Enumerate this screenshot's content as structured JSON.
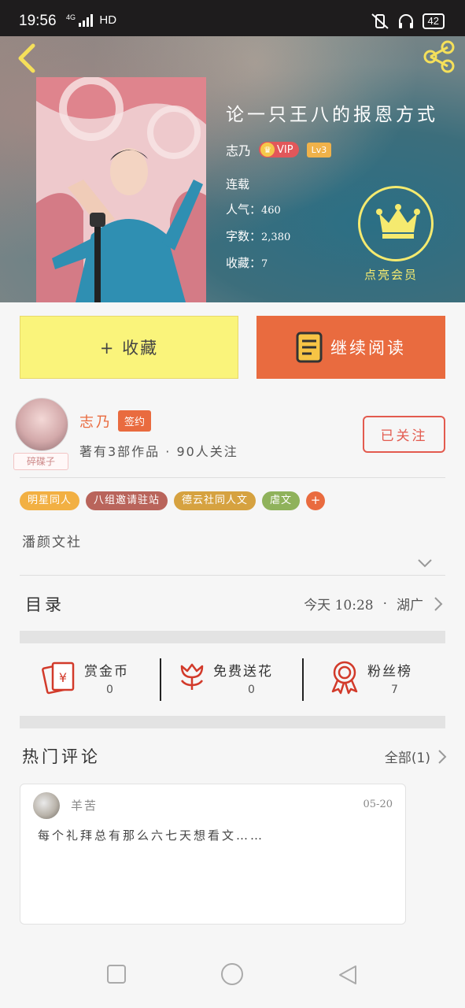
{
  "status_bar": {
    "time": "19:56",
    "network": "4G",
    "hd": "HD",
    "battery": "42"
  },
  "book": {
    "title": "论一只王八的报恩方式",
    "author": "志乃",
    "vip": "VIP",
    "level": "Lv3",
    "status": "连载",
    "popularity_label": "人气：",
    "popularity": "460",
    "words_label": "字数：",
    "words": "2,380",
    "favorites_label": "收藏：",
    "favorites": "7",
    "vip_cta": "点亮会员"
  },
  "actions": {
    "favorite": "+ 收藏",
    "continue_read": "继续阅读"
  },
  "author_panel": {
    "name": "志乃",
    "badge": "签约",
    "avatar_tag": "碎碟子",
    "stats": "著有3部作品 · 90人关注",
    "follow": "已关注"
  },
  "tags": [
    {
      "label": "明星同人",
      "color": "#f2b043"
    },
    {
      "label": "八组邀请驻站",
      "color": "#b9645b"
    },
    {
      "label": "德云社同人文",
      "color": "#d6a240"
    },
    {
      "label": "虐文",
      "color": "#8fb25b"
    }
  ],
  "tag_add": "+",
  "description": "潘颜文社",
  "toc": {
    "label": "目录",
    "updated": "今天 10:28",
    "dot": "·",
    "chapter": "湖广"
  },
  "rewards": [
    {
      "label": "赏金币",
      "value": "0"
    },
    {
      "label": "免费送花",
      "value": "0"
    },
    {
      "label": "粉丝榜",
      "value": "7"
    }
  ],
  "comments": {
    "title": "热门评论",
    "all": "全部(1)",
    "items": [
      {
        "user": "羊苦",
        "date": "05-20",
        "text": "每个礼拜总有那么六七天想看文……"
      }
    ]
  }
}
